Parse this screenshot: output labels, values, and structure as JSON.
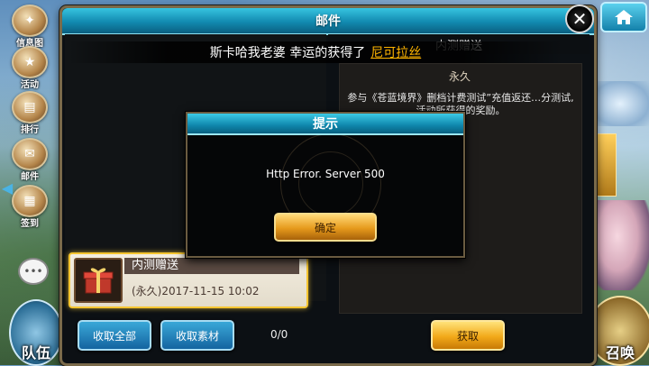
{
  "sidebar": {
    "items": [
      {
        "label": "信息图"
      },
      {
        "label": "活动"
      },
      {
        "label": "排行"
      },
      {
        "label": "邮件"
      },
      {
        "label": "签到"
      }
    ],
    "team_label": "队伍",
    "summon_label": "召唤"
  },
  "mail": {
    "title": "邮件",
    "announcement_prefix": "斯卡哈我老婆 幸运的获得了",
    "announcement_highlight": "尼可拉丝",
    "item": {
      "title": "内测赠送",
      "date": "(永久)2017-11-15  10:02"
    },
    "buttons": {
      "collect_all": "收取全部",
      "collect_materials": "收取素材"
    },
    "count": "0/0",
    "detail": {
      "header": "内测赠送",
      "duration": "永久",
      "body": "参与《苍蓝境界》删档计费测试”充值返还…分测试,活动所获得的奖励。",
      "get_button": "获取"
    }
  },
  "dialog": {
    "title": "提示",
    "message": "Http Error. Server 500",
    "confirm": "确定"
  },
  "colors": {
    "title_bar": "#1aa3c8",
    "highlight": "#ffb400",
    "selected_border": "#f5c530"
  }
}
